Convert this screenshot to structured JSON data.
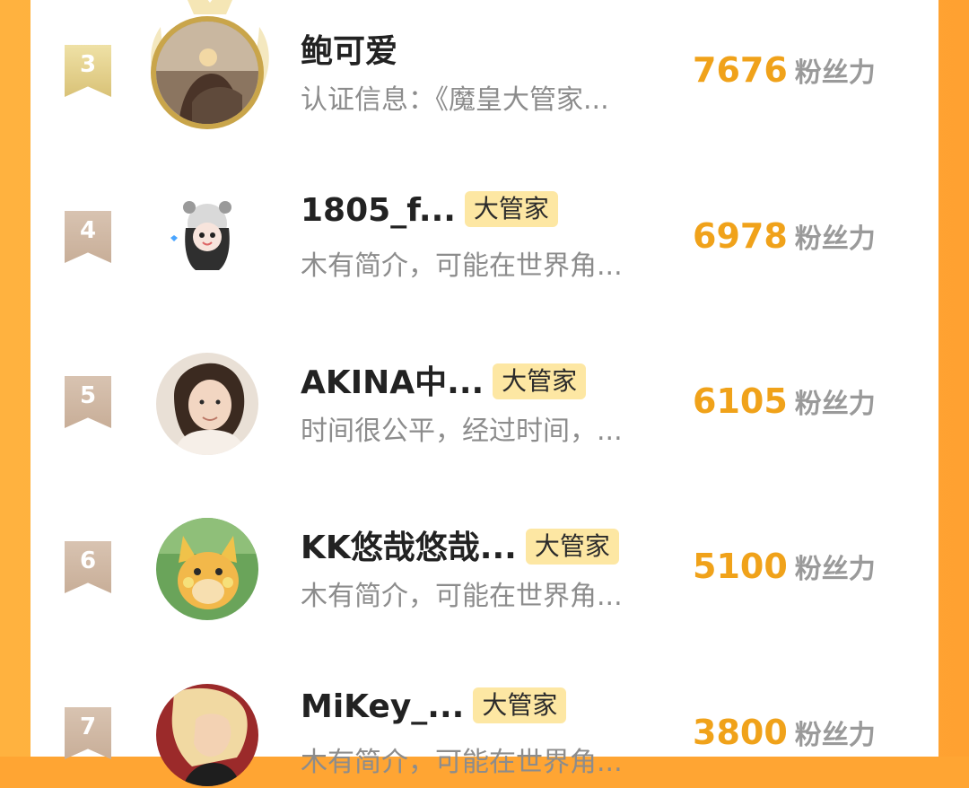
{
  "unit_label": "粉丝力",
  "badge_label": "大管家",
  "rows": [
    {
      "rank": "3",
      "name": "鲍可爱",
      "bio": "认证信息：《魔皇大管家...",
      "score": "7676"
    },
    {
      "rank": "4",
      "name": "1805_f...",
      "bio": "木有简介，可能在世界角...",
      "score": "6978"
    },
    {
      "rank": "5",
      "name": "AKINA中...",
      "bio": "时间很公平，经过时间，...",
      "score": "6105"
    },
    {
      "rank": "6",
      "name": "KK悠哉悠哉...",
      "bio": "木有简介，可能在世界角...",
      "score": "5100"
    },
    {
      "rank": "7",
      "name": "MiKey_...",
      "bio": "木有简介，可能在世界角...",
      "score": "3800"
    }
  ]
}
